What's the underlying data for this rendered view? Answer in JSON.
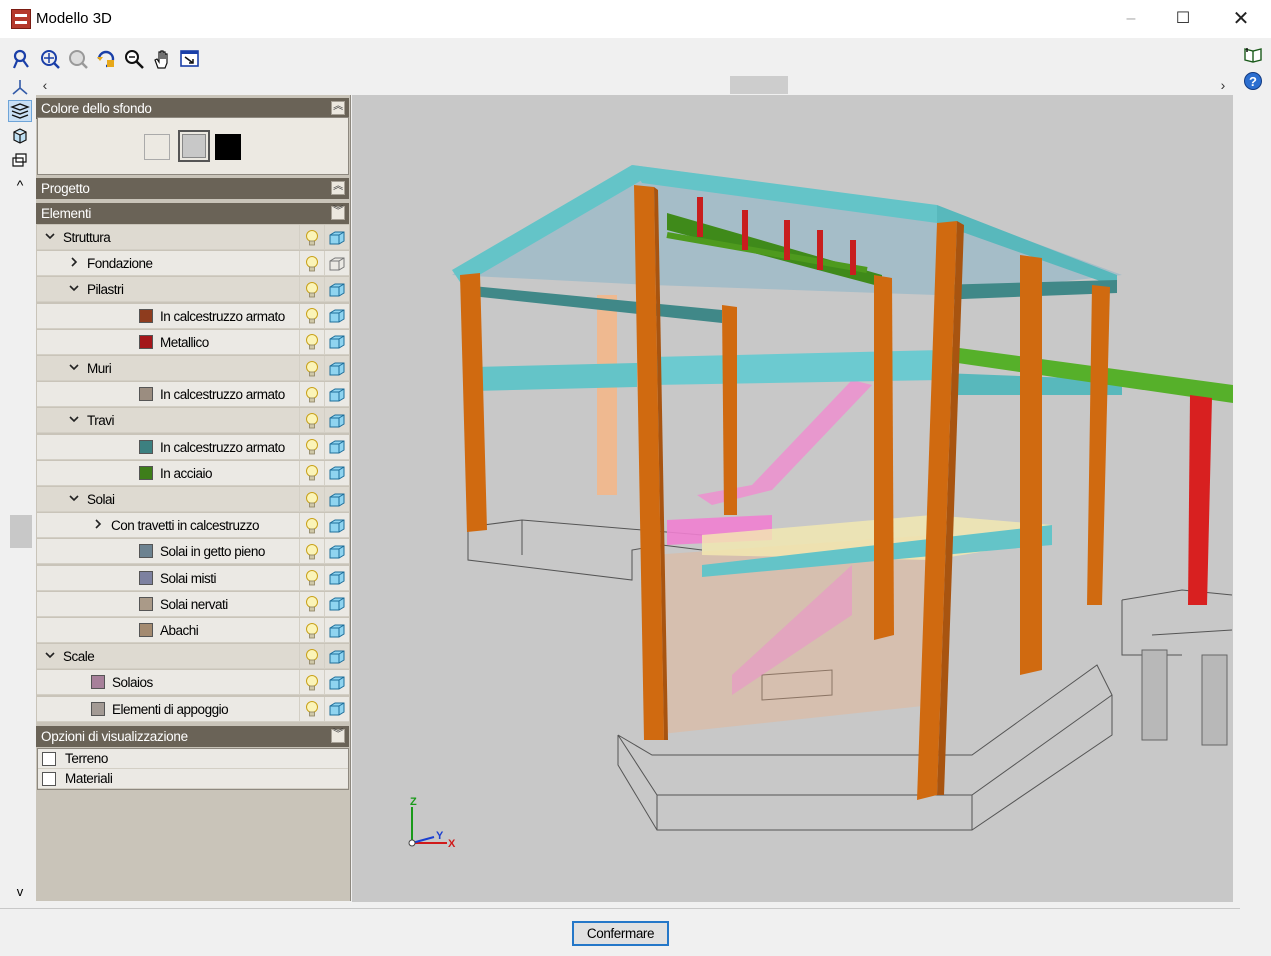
{
  "window": {
    "title": "Modello 3D",
    "controls": [
      "–",
      "☐",
      "✕"
    ]
  },
  "toolbar": {
    "icons": [
      "zoom-extents-icon",
      "zoom-window-icon",
      "zoom-previous-icon",
      "rotate-icon",
      "zoom-icon",
      "pan-hand-icon",
      "fit-view-icon"
    ]
  },
  "right_toolbar": {
    "icons": [
      "book-icon",
      "help-icon"
    ]
  },
  "side_toolbar": {
    "icons": [
      "axes-icon",
      "layers-icon",
      "cube-view-icon",
      "multi-view-icon"
    ]
  },
  "scroll": {
    "left": "‹",
    "right": "›",
    "up": "^",
    "down": "v"
  },
  "background_section": {
    "title": "Colore dello sfondo",
    "swatches": [
      "#ffffff",
      "#c8c8c8",
      "#000000"
    ]
  },
  "project_section": {
    "title": "Progetto"
  },
  "elements_section": {
    "title": "Elementi",
    "rows": [
      {
        "label": "Struttura",
        "color": ""
      },
      {
        "label": "Fondazione",
        "color": ""
      },
      {
        "label": "Pilastri",
        "color": ""
      },
      {
        "label": "In calcestruzzo armato",
        "color": "#8e3c1e"
      },
      {
        "label": "Metallico",
        "color": "#a4161a"
      },
      {
        "label": "Muri",
        "color": ""
      },
      {
        "label": "In calcestruzzo armato",
        "color": "#9b8d80"
      },
      {
        "label": "Travi",
        "color": ""
      },
      {
        "label": "In calcestruzzo armato",
        "color": "#3c8080"
      },
      {
        "label": "In acciaio",
        "color": "#3e7e1a"
      },
      {
        "label": "Solai",
        "color": ""
      },
      {
        "label": "Con travetti in calcestruzzo",
        "color": ""
      },
      {
        "label": "Solai in getto pieno",
        "color": "#6c8290"
      },
      {
        "label": "Solai misti",
        "color": "#7d81a0"
      },
      {
        "label": "Solai nervati",
        "color": "#aa9a88"
      },
      {
        "label": "Abachi",
        "color": "#a38a70"
      },
      {
        "label": "Scale",
        "color": ""
      },
      {
        "label": "Solaios",
        "color": "#a7809a"
      },
      {
        "label": "Elementi di appoggio",
        "color": "#a39a94"
      }
    ]
  },
  "options_section": {
    "title": "Opzioni di visualizzazione",
    "options": [
      {
        "label": "Terreno",
        "checked": false
      },
      {
        "label": "Materiali",
        "checked": false
      }
    ]
  },
  "viewport": {
    "background": "#c8c8c8",
    "axes": {
      "z": "Z",
      "y": "Y",
      "x": "X"
    }
  },
  "footer": {
    "confirm_label": "Confermare"
  }
}
